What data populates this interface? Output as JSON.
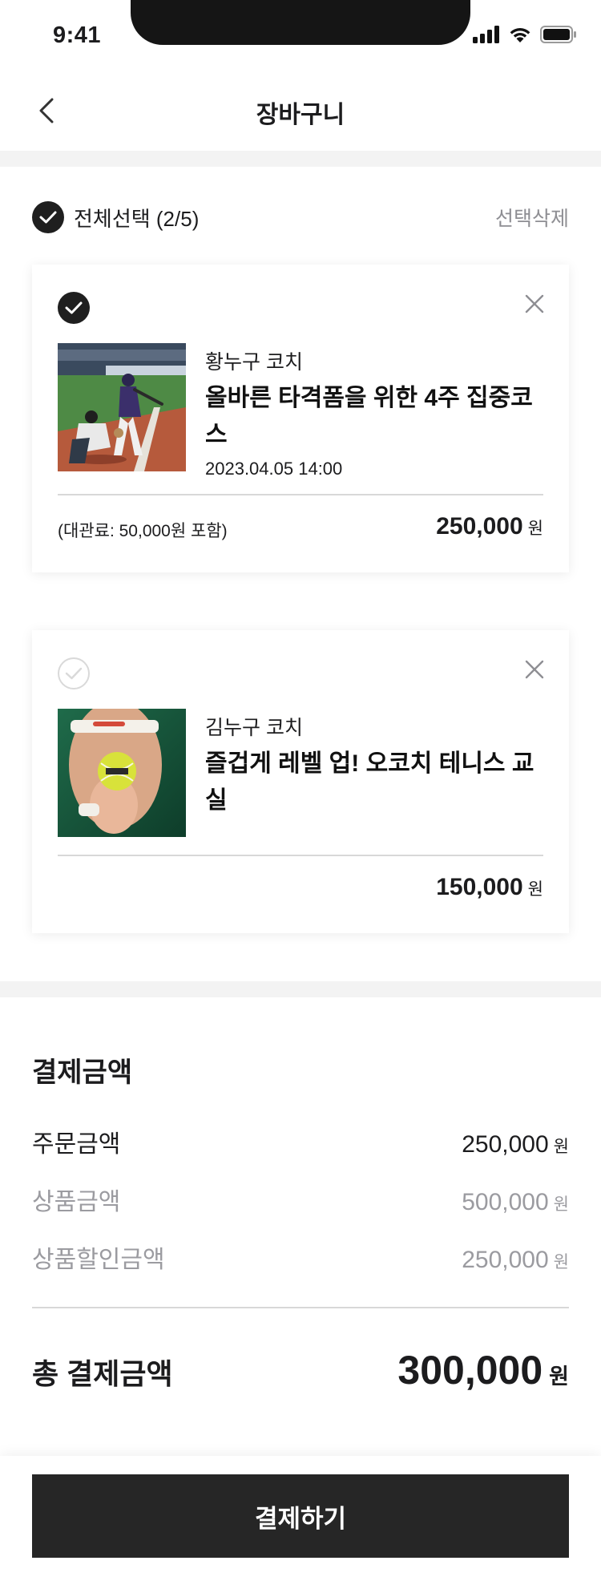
{
  "status_bar": {
    "time": "9:41"
  },
  "header": {
    "title": "장바구니"
  },
  "cart": {
    "select_all_label": "전체선택 (2/5)",
    "delete_selected_label": "선택삭제",
    "items": [
      {
        "checked": true,
        "coach": "황누구 코치",
        "title": "올바른 타격폼을 위한 4주 집중코스",
        "date": "2023.04.05 14:00",
        "fee_note": "(대관료: 50,000원 포함)",
        "price": "250,000",
        "unit": "원",
        "image": "baseball-batter-photo"
      },
      {
        "checked": false,
        "coach": "김누구 코치",
        "title": "즐겁게 레벨 업! 오코치 테니스 교실",
        "price": "150,000",
        "unit": "원",
        "image": "tennis-ball-photo"
      }
    ]
  },
  "summary": {
    "title": "결제금액",
    "rows": [
      {
        "label": "주문금액",
        "value": "250,000",
        "unit": "원",
        "muted": false
      },
      {
        "label": "상품금액",
        "value": "500,000",
        "unit": "원",
        "muted": true
      },
      {
        "label": "상품할인금액",
        "value": "250,000",
        "unit": "원",
        "muted": true
      }
    ],
    "total_label": "총 결제금액",
    "total_value": "300,000",
    "total_unit": "원"
  },
  "checkout": {
    "button_label": "결제하기"
  },
  "colors": {
    "primary_dark": "#262626",
    "muted_text": "#9b9ba0",
    "divider": "#d8d8d8",
    "band": "#f3f3f3"
  }
}
